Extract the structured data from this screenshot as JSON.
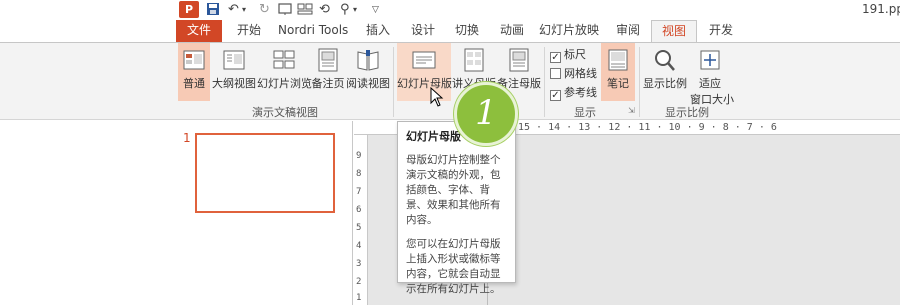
{
  "title_bar": {
    "app_logo": "P",
    "file_name": "191.pp",
    "icons": [
      "save-icon",
      "undo-icon",
      "redo-icon",
      "presentation-icon",
      "speaker-icon",
      "customize-icon"
    ]
  },
  "tabs": [
    {
      "label": "文件"
    },
    {
      "label": "开始"
    },
    {
      "label": "Nordri Tools"
    },
    {
      "label": "插入"
    },
    {
      "label": "设计"
    },
    {
      "label": "切换"
    },
    {
      "label": "动画"
    },
    {
      "label": "幻灯片放映"
    },
    {
      "label": "审阅"
    },
    {
      "label": "视图"
    },
    {
      "label": "开发"
    }
  ],
  "ribbon": {
    "presentation_views": {
      "group_label": "演示文稿视图",
      "buttons": [
        "普通",
        "大纲视图",
        "幻灯片浏览",
        "备注页",
        "阅读视图"
      ]
    },
    "master_views": {
      "buttons": [
        "幻灯片母版",
        "讲义母版",
        "备注母版"
      ]
    },
    "show": {
      "group_label": "显示",
      "checkboxes": [
        {
          "label": "标尺",
          "checked": true
        },
        {
          "label": "网格线",
          "checked": false
        },
        {
          "label": "参考线",
          "checked": true
        }
      ],
      "notes_button": "笔记"
    },
    "zoom": {
      "group_label": "显示比例",
      "zoom_button": "显示比例",
      "fit_button_line1": "适应",
      "fit_button_line2": "窗口大小"
    }
  },
  "slides": [
    {
      "number": "1"
    }
  ],
  "ruler_text": "15 · 14 · 13 · 12 · 11 · 10 · 9 · 8 · 7 · 6",
  "vertical_ruler": [
    "9",
    "8",
    "7",
    "6",
    "5",
    "4",
    "3",
    "2",
    "1"
  ],
  "tooltip": {
    "title": "幻灯片母版",
    "para1": "母版幻灯片控制整个演示文稿的外观，包括颜色、字体、背景、效果和其他所有内容。",
    "para2": "您可以在幻灯片母版上插入形状或徽标等内容，它就会自动显示在所有幻灯片上。"
  },
  "step_badge": "1",
  "colors": {
    "accent": "#d24726",
    "selected": "#f7cab5",
    "badge": "#8dbf3d"
  }
}
